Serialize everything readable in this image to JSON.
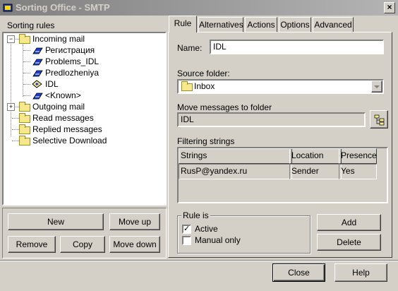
{
  "window": {
    "title": "Sorting Office - SMTP",
    "close_glyph": "×"
  },
  "left": {
    "label": "Sorting rules",
    "tree": [
      {
        "label": "Incoming mail",
        "type": "folder",
        "toggle": "−"
      },
      {
        "label": "Регистрация",
        "type": "rule"
      },
      {
        "label": "Problems_IDL",
        "type": "rule"
      },
      {
        "label": "Predlozheniya",
        "type": "rule"
      },
      {
        "label": "IDL",
        "type": "rule-selected"
      },
      {
        "label": "<Known>",
        "type": "rule"
      },
      {
        "label": "Outgoing mail",
        "type": "folder",
        "toggle": "+"
      },
      {
        "label": "Read messages",
        "type": "folder"
      },
      {
        "label": "Replied messages",
        "type": "folder"
      },
      {
        "label": "Selective Download",
        "type": "folder"
      }
    ],
    "buttons": {
      "new": "New",
      "move_up": "Move up",
      "remove": "Remove",
      "copy": "Copy",
      "move_down": "Move down"
    }
  },
  "tabs": [
    "Rule",
    "Alternatives",
    "Actions",
    "Options",
    "Advanced"
  ],
  "rule": {
    "name_label": "Name:",
    "name_value": "IDL",
    "source_label": "Source folder:",
    "source_value": "Inbox",
    "move_label": "Move messages to folder",
    "move_value": "IDL",
    "filter_label": "Filtering strings",
    "grid_headers": [
      "Strings",
      "Location",
      "Presence"
    ],
    "grid_rows": [
      [
        "RusP@yandex.ru",
        "Sender",
        "Yes"
      ]
    ],
    "rule_is_label": "Rule is",
    "active_label": "Active",
    "active_checked": true,
    "manual_label": "Manual only",
    "manual_checked": false,
    "add_label": "Add",
    "delete_label": "Delete"
  },
  "footer": {
    "close": "Close",
    "help": "Help"
  },
  "colors": {
    "titlebar": "#808080",
    "face": "#d4d0c8",
    "folder": "#f7e98a",
    "rule_icon": "#1a3cc8"
  }
}
